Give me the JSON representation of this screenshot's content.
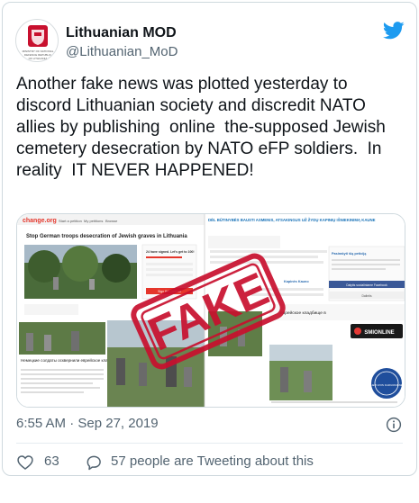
{
  "account": {
    "display_name": "Lithuanian MOD",
    "handle": "@Lithuanian_MoD",
    "avatar_caption": "MINISTRY OF NATIONAL DEFENCE REPUBLIC OF LITHUANIA"
  },
  "tweet": {
    "text": "Another fake news was plotted yesterday to discord Lithuanian society and discredit NATO allies by publishing  online  the-supposed Jewish cemetery desecration by NATO eFP soldiers.  In reality  IT NEVER HAPPENED!",
    "timestamp": "6:55 AM · Sep 27, 2019"
  },
  "media": {
    "stamp_text": "FAKE",
    "left_panel": {
      "site_name": "change.org",
      "nav": [
        "Start a petition",
        "My petitions",
        "Browse"
      ],
      "headline": "Stop German troops desecration of Jewish graves in Lithuania",
      "signed_text": "24 have signed. Let's get to 100!",
      "sign_button": "Sign this petition",
      "caption_ru": "Немецкие солдаты осквернили еврейское кладбище в Каунасе"
    },
    "right_panel": {
      "headline": "DĖL BŪTINYBĖS BAUSTI ASMENIS, ATSAKINGUS UŽ ŽYDŲ KAPINIŲ IŠNIEKINIMĄ KAUNE",
      "petition_title": "Pasirašyti šią peticiją",
      "petition_author": "Kapinės Kauno",
      "share_button": "Dalintis",
      "fb_button": "Dalytis socialiniame Facebook",
      "caption_ru": "еврейское кладбище в",
      "badge": "SMIONLINE",
      "seal_text": "LIETUVOS KARIUOMENĖ"
    }
  },
  "actions": {
    "likes": "63",
    "talking": "57 people are Tweeting about this"
  },
  "colors": {
    "twitter_blue": "#1d9bf0",
    "stamp_red": "#c8102e",
    "text_primary": "#0f1419",
    "text_secondary": "#536471"
  }
}
